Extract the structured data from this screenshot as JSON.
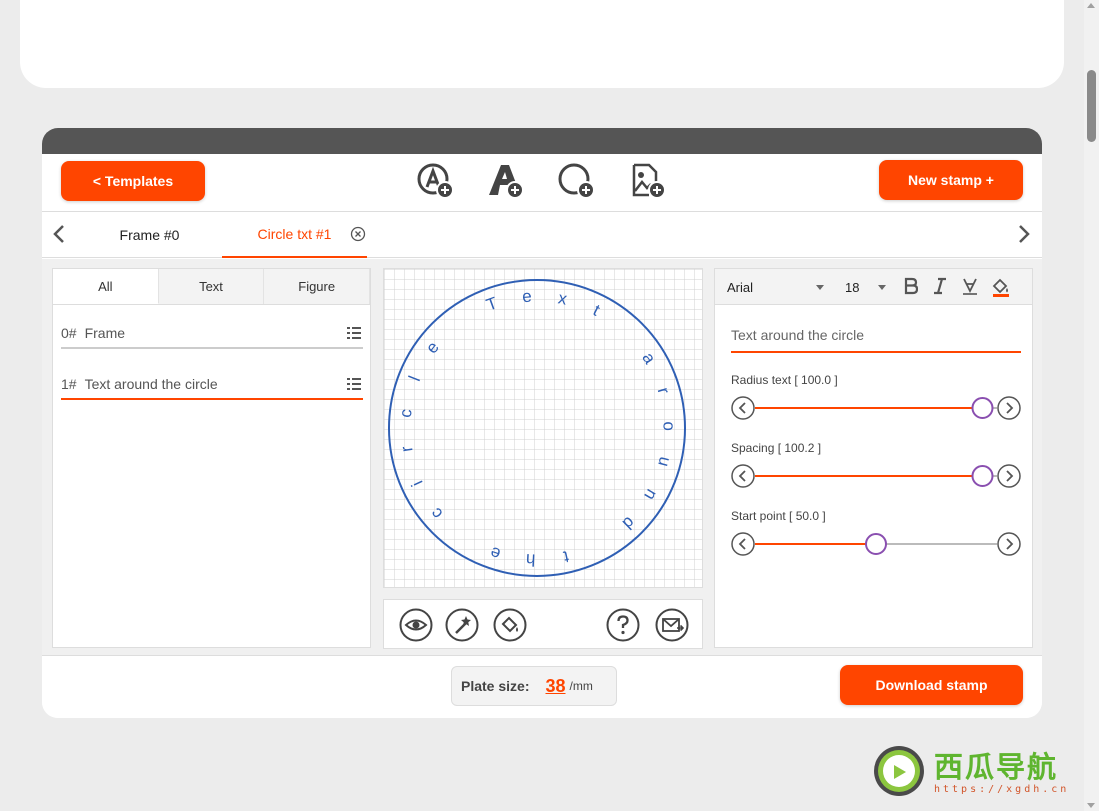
{
  "toolbar": {
    "templates_label": "<  Templates",
    "new_stamp_label": "New stamp +",
    "tools": [
      "add-text-icon",
      "add-letter-icon",
      "add-circle-icon",
      "add-image-icon"
    ]
  },
  "tabs": {
    "items": [
      {
        "label": "Frame #0"
      },
      {
        "label": "Circle txt #1"
      }
    ],
    "active": "Circle txt #1"
  },
  "left_panel": {
    "filters": [
      "All",
      "Text",
      "Figure"
    ],
    "active_filter": "All",
    "layers": [
      {
        "num": "0#",
        "name": "Frame"
      },
      {
        "num": "1#",
        "name": "Text around the circle"
      }
    ]
  },
  "canvas": {
    "circle_text": "Text around the circle",
    "stroke_color": "#2f5fb4"
  },
  "right_panel": {
    "font": "Arial",
    "font_size": "18",
    "text_value": "Text around the circle",
    "sliders": [
      {
        "label": "Radius text [ 100.0 ]",
        "value": 0.94
      },
      {
        "label": "Spacing [ 100.2 ]",
        "value": 0.94
      },
      {
        "label": "Start point [ 50.0 ]",
        "value": 0.5
      }
    ]
  },
  "footer": {
    "plate_label": "Plate size:",
    "plate_value": "38",
    "plate_unit": "/mm",
    "download_label": "Download stamp"
  },
  "watermark": {
    "title": "西瓜导航",
    "url": "https://xgdh.cn"
  },
  "colors": {
    "accent": "#ff4500",
    "header": "#555555",
    "slider_knob": "#8a4fb0"
  }
}
